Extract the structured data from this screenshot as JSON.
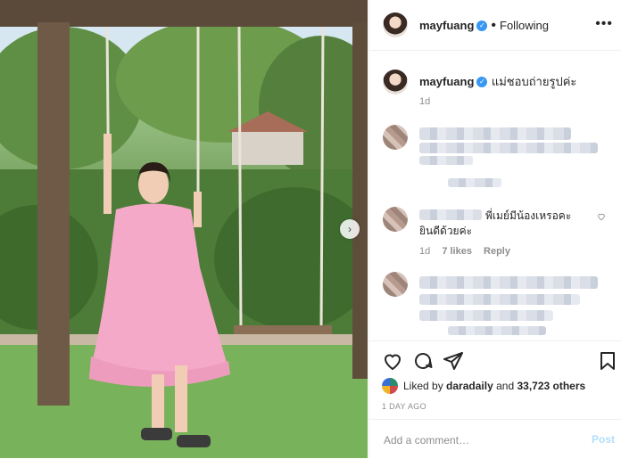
{
  "post": {
    "image_alt": "Woman in pink dress on a wooden swing in a garden",
    "next_arrow": "›"
  },
  "header": {
    "username": "mayfuang",
    "verified_icon": "verified-badge-icon",
    "separator": "•",
    "following": "Following",
    "more": "•••"
  },
  "caption": {
    "username": "mayfuang",
    "text": "แม่ชอบถ่ายรูปค่ะ",
    "time": "1d"
  },
  "comments": [
    {
      "blurred": true
    },
    {
      "text_line1": "พี่เมย์มีน้องเหรอคะ",
      "text_line2": "ยินดีด้วยค่ะ",
      "time": "1d",
      "likes": "7 likes",
      "reply": "Reply"
    },
    {
      "blurred": true
    }
  ],
  "actions": {
    "icons": [
      "heart-icon",
      "comment-icon",
      "share-icon",
      "bookmark-icon"
    ]
  },
  "likes": {
    "prefix": "Liked by",
    "user": "daradaily",
    "and": "and",
    "count": "33,723 others"
  },
  "date": "1 DAY AGO",
  "comment_input": {
    "placeholder": "Add a comment…",
    "post_label": "Post"
  },
  "colors": {
    "accent": "#3897f0",
    "post_disabled": "#b2dffc",
    "dress": "#f4a9c8"
  }
}
